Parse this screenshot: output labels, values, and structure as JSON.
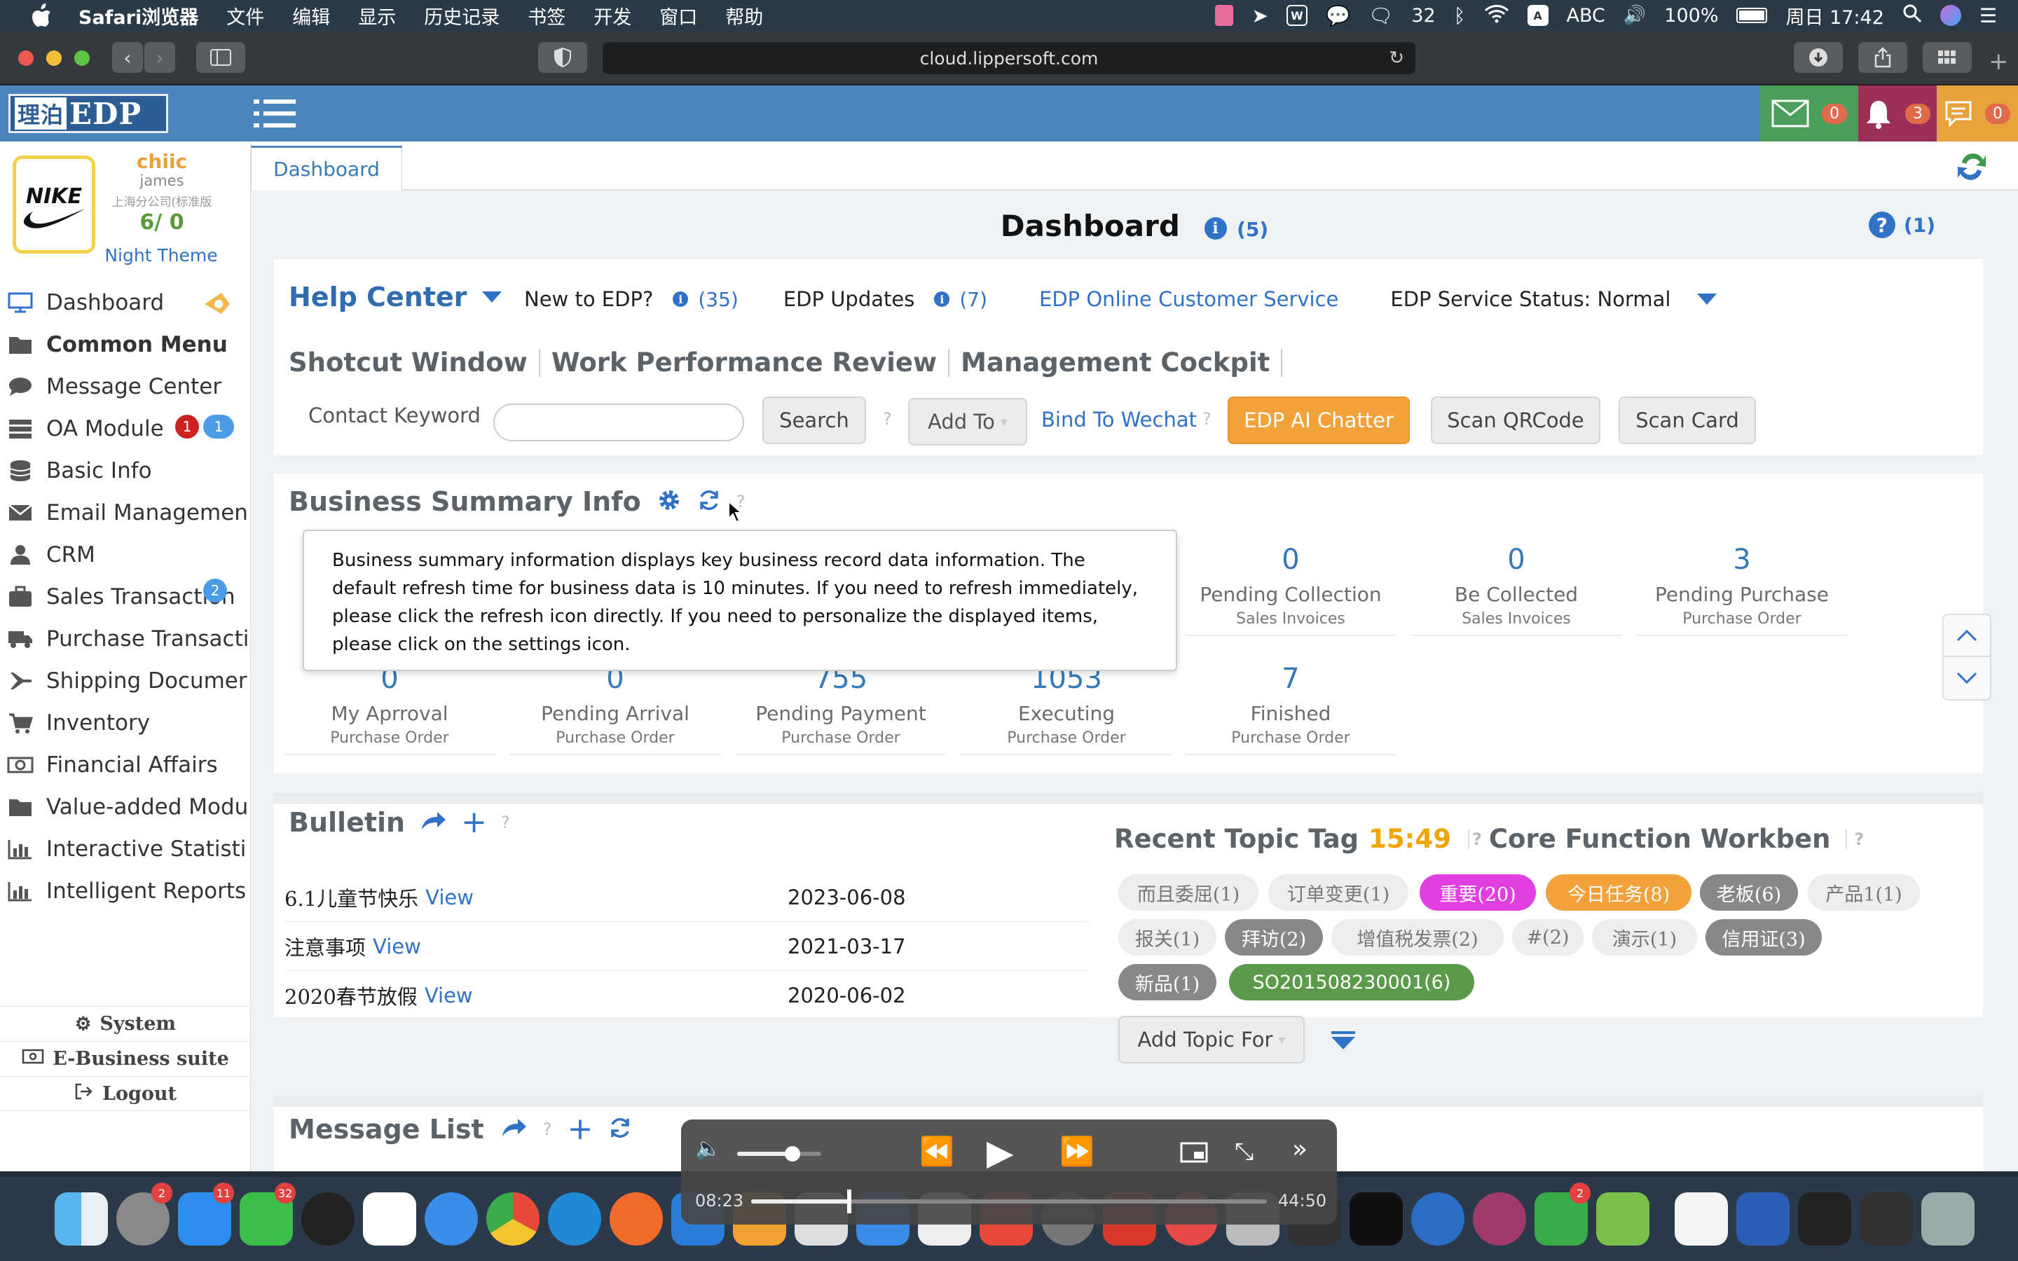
{
  "menubar": {
    "app_name": "Safari浏览器",
    "menus": [
      "文件",
      "编辑",
      "显示",
      "历史记录",
      "书签",
      "开发",
      "窗口",
      "帮助"
    ],
    "wechat_count": "32",
    "input_method": "ABC",
    "battery": "100%",
    "clock": "周日 17:42"
  },
  "browser": {
    "url": "cloud.lippersoft.com"
  },
  "header": {
    "logo_cn": "理泊",
    "logo_en": "EDP",
    "mail_count": "0",
    "notify_count": "3",
    "message_count": "0"
  },
  "sidebar": {
    "user_name": "chiic",
    "user_login": "james",
    "company": "上海分公司(标准版",
    "counts": "6/ 0",
    "theme_link": "Night Theme",
    "items": [
      {
        "label": "Dashboard",
        "icon": "monitor-icon"
      },
      {
        "label": "Common Menu",
        "icon": "folder-icon"
      },
      {
        "label": "Message Center",
        "icon": "chat-icon"
      },
      {
        "label": "OA Module",
        "icon": "server-icon",
        "badge_red": "1",
        "badge_blue": "1"
      },
      {
        "label": "Basic Info",
        "icon": "database-icon"
      },
      {
        "label": "Email Managemen",
        "icon": "envelope-icon"
      },
      {
        "label": "CRM",
        "icon": "user-icon"
      },
      {
        "label": "Sales Transaction",
        "icon": "briefcase-icon",
        "badge_blue": "2"
      },
      {
        "label": "Purchase Transacti",
        "icon": "truck-icon"
      },
      {
        "label": "Shipping Documer",
        "icon": "plane-icon"
      },
      {
        "label": "Inventory",
        "icon": "cart-icon"
      },
      {
        "label": "Financial Affairs",
        "icon": "money-icon"
      },
      {
        "label": "Value-added Modu",
        "icon": "folder-icon"
      },
      {
        "label": "Interactive Statisti",
        "icon": "bar-chart-icon"
      },
      {
        "label": "Intelligent Reports",
        "icon": "bar-chart-icon"
      }
    ],
    "system": "System",
    "ebusiness": "E-Business suite",
    "logout": "Logout"
  },
  "tabs": {
    "dashboard": "Dashboard"
  },
  "dashboard": {
    "title": "Dashboard",
    "title_count": "(5)",
    "help_count": "(1)"
  },
  "help_center": {
    "title": "Help Center",
    "new_to_edp": "New to EDP?",
    "new_count": "(35)",
    "updates": "EDP Updates",
    "updates_count": "(7)",
    "online_service": "EDP Online Customer Service",
    "service_status": "EDP Service Status: Normal",
    "nav": [
      "Shotcut Window",
      "Work Performance Review",
      "Management Cockpit"
    ],
    "contact_label": "Contact Keyword",
    "contact_value": "",
    "search_btn": "Search",
    "add_to": "Add To",
    "bind_wechat": "Bind To Wechat",
    "ai_chatter": "EDP AI Chatter",
    "scan_qr": "Scan QRCode",
    "scan_card": "Scan Card",
    "question_mark": "?"
  },
  "business_summary": {
    "title": "Business Summary Info",
    "tooltip": "Business summary information displays key business record data information. The default refresh time for business data is 10 minutes. If you need to refresh immediately, please click the refresh icon directly. If you need to personalize the displayed items, please click on the settings icon.",
    "row1": [
      {
        "value": "0",
        "label": "Pending Collection",
        "sub": "Sales Invoices"
      },
      {
        "value": "0",
        "label": "Be Collected",
        "sub": "Sales Invoices"
      },
      {
        "value": "3",
        "label": "Pending Purchase",
        "sub": "Purchase Order"
      }
    ],
    "row2": [
      {
        "value": "0",
        "label": "My Aprroval",
        "sub": "Purchase Order"
      },
      {
        "value": "0",
        "label": "Pending Arrival",
        "sub": "Purchase Order"
      },
      {
        "value": "755",
        "label": "Pending Payment",
        "sub": "Purchase Order"
      },
      {
        "value": "1053",
        "label": "Executing",
        "sub": "Purchase Order"
      },
      {
        "value": "7",
        "label": "Finished",
        "sub": "Purchase Order"
      }
    ]
  },
  "bulletin": {
    "title": "Bulletin",
    "view": "View",
    "rows": [
      {
        "title": "6.1儿童节快乐",
        "date": "2023-06-08"
      },
      {
        "title": "注意事项",
        "date": "2021-03-17"
      },
      {
        "title": "2020春节放假",
        "date": "2020-06-02"
      }
    ]
  },
  "topics": {
    "title": "Recent Topic Tag",
    "time": "15:49",
    "workbench": "Core Function Workben",
    "tags": [
      {
        "label": "而且委屈(1)",
        "style": "gray"
      },
      {
        "label": "订单变更(1)",
        "style": "gray"
      },
      {
        "label": "重要(20)",
        "style": "pink"
      },
      {
        "label": "今日任务(8)",
        "style": "orange"
      },
      {
        "label": "老板(6)",
        "style": "dark"
      },
      {
        "label": "产品1(1)",
        "style": "gray"
      },
      {
        "label": "报关(1)",
        "style": "gray"
      },
      {
        "label": "拜访(2)",
        "style": "dark"
      },
      {
        "label": "增值税发票(2)",
        "style": "gray"
      },
      {
        "label": "#(2)",
        "style": "gray"
      },
      {
        "label": "演示(1)",
        "style": "gray"
      },
      {
        "label": "信用证(3)",
        "style": "dark"
      },
      {
        "label": "新品(1)",
        "style": "dark"
      },
      {
        "label": "SO201508230001(6)",
        "style": "green"
      }
    ],
    "add_topic": "Add Topic For"
  },
  "message_list": {
    "title": "Message List"
  },
  "video": {
    "elapsed": "08:23",
    "total": "44:50",
    "progress": 0.19,
    "volume": 0.66
  },
  "colors": {
    "accent": "#4a86bd",
    "link": "#2f72c8",
    "ai_button": "#f2a23b",
    "time_highlight": "#f0a500"
  }
}
